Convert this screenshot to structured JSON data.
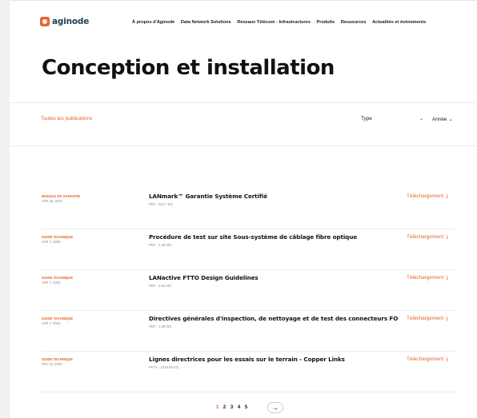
{
  "brand": {
    "name": "aginode",
    "accent": "#e8622b",
    "logo_text_color": "#1d3f53"
  },
  "nav": {
    "items": [
      "À propos d'Aginode",
      "Data Network Solutions",
      "Réseaux Télécom - Infrastructures",
      "Produits",
      "Ressources",
      "Actualités et événements"
    ]
  },
  "page": {
    "title": "Conception et installation"
  },
  "filters": {
    "all": "Toutes les publications",
    "type": "Type",
    "type_chevron": "⌄",
    "year": "Année ⌄"
  },
  "publications": [
    {
      "category": "Module de garantie",
      "date": "Avr 18, 2023",
      "title": "LANmark™ Garantie Système Certifié",
      "meta": "PDF - 544.7 KO",
      "download": "Téléchargement"
    },
    {
      "category": "Guide technique",
      "date": "Avr 7, 2023",
      "title": "Procédure de test sur site Sous-système de câblage fibre optique",
      "meta": "PDF - 2.45 MO",
      "download": "Téléchargement"
    },
    {
      "category": "Guide technique",
      "date": "Avr 7, 2023",
      "title": "LANactive FTTO Design Guidelines",
      "meta": "PDF - 2.02 MO",
      "download": "Téléchargement"
    },
    {
      "category": "Guide technique",
      "date": "Avr 7, 2023",
      "title": "Directives générales d'inspection, de nettoyage et de test des connecteurs FO",
      "meta": "PDF - 1.36 MO",
      "download": "Téléchargement"
    },
    {
      "category": "Guide technique",
      "date": "Fév 23, 2023",
      "title": "Lignes directrices pour les essais sur le terrain - Copper Links",
      "meta": "PPTX - 1019.55 KO",
      "download": "Téléchargement"
    }
  ],
  "pagination": {
    "pages": [
      "1",
      "2",
      "3",
      "4",
      "5"
    ],
    "current": "1",
    "next": "→"
  },
  "icons": {
    "download": "download-icon",
    "next": "arrow-right-icon"
  }
}
